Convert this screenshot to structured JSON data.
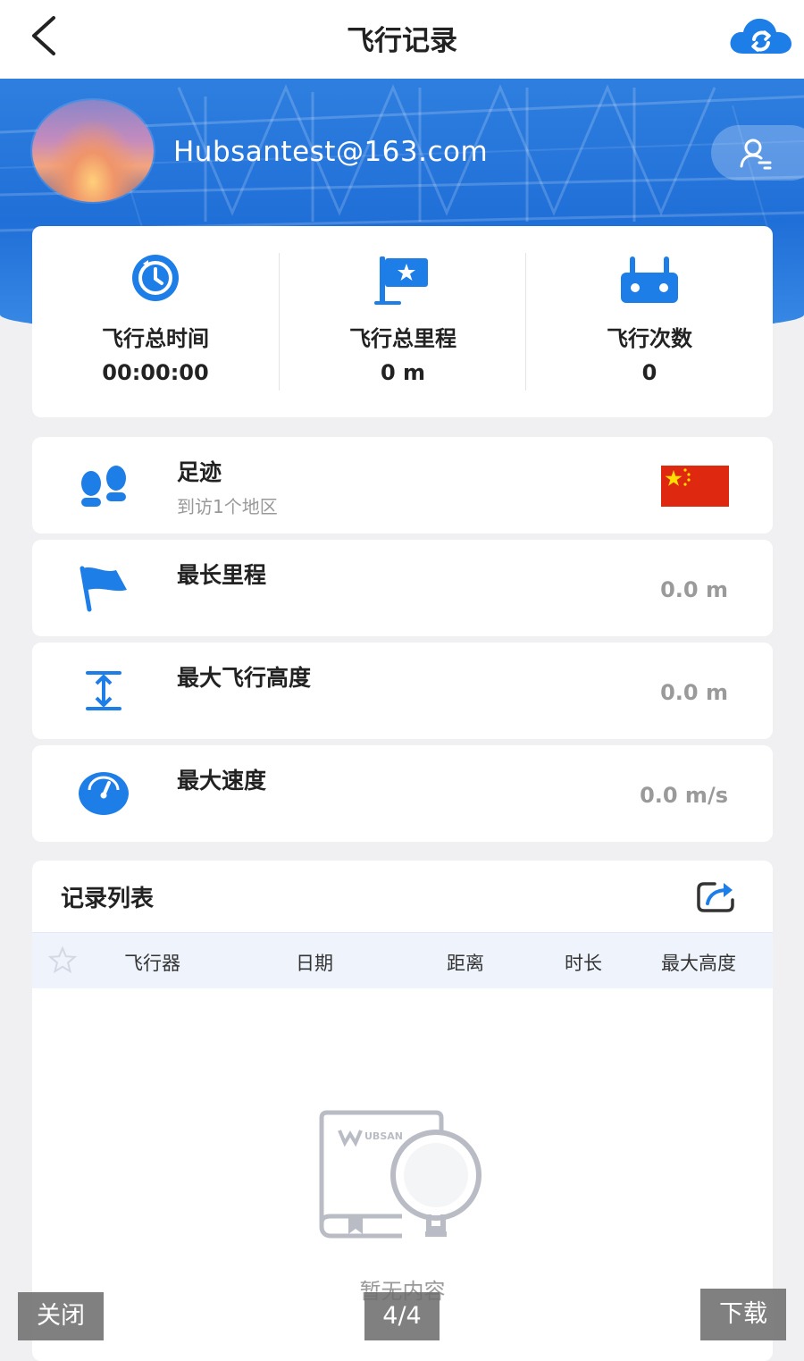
{
  "header": {
    "title": "飞行记录",
    "back_icon": "back-arrow-icon",
    "sync_icon": "cloud-sync-icon"
  },
  "profile": {
    "email": "Hubsantest@163.com",
    "avatar": "sunset-landscape-avatar",
    "switch_icon": "user-switch-icon"
  },
  "stats": [
    {
      "label": "飞行总时间",
      "value": "00:00:00",
      "icon": "clock-icon"
    },
    {
      "label": "飞行总里程",
      "value": "0 m",
      "icon": "flag-star-icon"
    },
    {
      "label": "飞行次数",
      "value": "0",
      "icon": "remote-controller-icon"
    }
  ],
  "records": {
    "footprint": {
      "label": "足迹",
      "sub": "到访1个地区",
      "icon": "footprints-icon",
      "flag": "china-flag"
    },
    "longest": {
      "label": "最长里程",
      "value": "0.0 m",
      "icon": "flag-icon"
    },
    "max_height": {
      "label": "最大飞行高度",
      "value": "0.0 m",
      "icon": "height-icon"
    },
    "max_speed": {
      "label": "最大速度",
      "value": "0.0 m/s",
      "icon": "speedometer-icon"
    }
  },
  "list": {
    "title": "记录列表",
    "share_icon": "share-icon",
    "columns": [
      "飞行器",
      "日期",
      "距离",
      "时长",
      "最大高度"
    ],
    "star_icon": "star-icon",
    "empty_text": "暂无内容",
    "empty_logo": "UBSAN"
  },
  "overlay": {
    "close": "关闭",
    "pager": "4/4",
    "download": "下载"
  },
  "colors": {
    "accent": "#1e7ee8",
    "hero_blue": "#1f6fd8",
    "muted_value": "#9a9a9a",
    "flag_red": "#de2910",
    "flag_star": "#ffde00"
  }
}
